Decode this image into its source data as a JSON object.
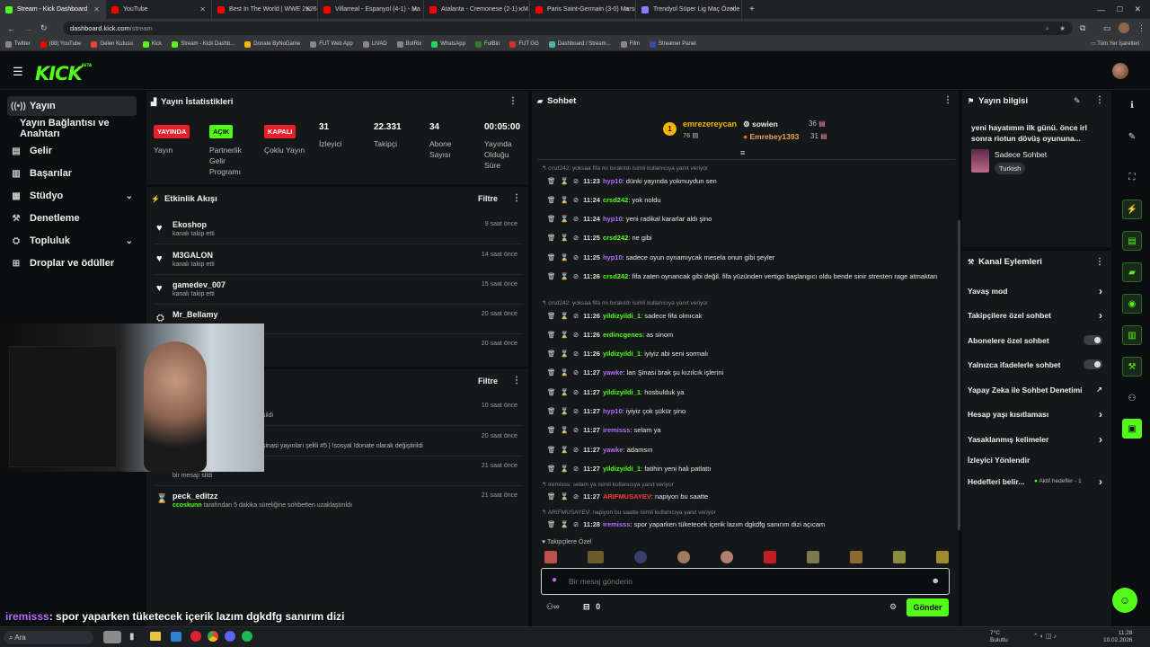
{
  "browser": {
    "tabs": [
      {
        "label": "Stream - Kick Dashboard",
        "color": "#53fc18",
        "active": true
      },
      {
        "label": "YouTube",
        "color": "#ff0000",
        "active": false
      },
      {
        "label": "Best In The World | WWE 2K26",
        "color": "#ff0000",
        "active": false
      },
      {
        "label": "Villarreal - Espanyol (4-1) - Ma",
        "color": "#ff0000",
        "active": false
      },
      {
        "label": "Atalanta - Cremonese (2-1) - M",
        "color": "#ff0000",
        "active": false
      },
      {
        "label": "Paris Saint-Germain (3-0) Marsi",
        "color": "#ff0000",
        "active": false
      },
      {
        "label": "Trendyol Süper Lig Maç Özetle",
        "color": "#8a7cff",
        "active": false
      }
    ],
    "url_domain": "dashboard.kick.com",
    "url_path": "/stream",
    "bookmarks": [
      {
        "label": "Twitter",
        "color": "#888"
      },
      {
        "label": "(88) YouTube",
        "color": "#ff0000"
      },
      {
        "label": "Gelen Kutusu",
        "color": "#ea4335"
      },
      {
        "label": "Kick",
        "color": "#53fc18"
      },
      {
        "label": "Stream - Kick Dashb...",
        "color": "#53fc18"
      },
      {
        "label": "Donate ByNoGame",
        "color": "#f5b400"
      },
      {
        "label": "FUT Web App",
        "color": "#888"
      },
      {
        "label": "LIVAD",
        "color": "#888"
      },
      {
        "label": "BotRix",
        "color": "#888"
      },
      {
        "label": "WhatsApp",
        "color": "#25d366"
      },
      {
        "label": "FutBin",
        "color": "#2e7d32"
      },
      {
        "label": "FUT GG",
        "color": "#d32f2f"
      },
      {
        "label": "Dashboard / Stream...",
        "color": "#4db6ac"
      },
      {
        "label": "Film",
        "color": "#888"
      },
      {
        "label": "Streamer Panel",
        "color": "#3949ab"
      }
    ],
    "all_bookmarks": "Tüm Yer İşaretleri"
  },
  "app": {
    "logo": "KICK",
    "logo_beta": "BETA",
    "accent": "#53fc18"
  },
  "sidebar": {
    "items": [
      {
        "label": "Yayın",
        "icon": "broadcast-icon"
      },
      {
        "label": "Yayın Bağlantısı ve Anahtarı",
        "icon": ""
      },
      {
        "label": "Gelir",
        "icon": "revenue-icon"
      },
      {
        "label": "Başarılar",
        "icon": "achievements-icon"
      },
      {
        "label": "Stüdyo",
        "icon": "studio-icon"
      },
      {
        "label": "Denetleme",
        "icon": "moderation-icon"
      },
      {
        "label": "Topluluk",
        "icon": "community-icon"
      },
      {
        "label": "Droplar ve ödüller",
        "icon": "gift-icon"
      }
    ]
  },
  "stats": {
    "title": "Yayın İstatistikleri",
    "items": [
      {
        "badge": "YAYINDA",
        "label": "Yayın"
      },
      {
        "badge": "AÇIK",
        "label": "Partnerlik Gelir Programı"
      },
      {
        "badge": "KAPALI",
        "label": "Çoklu Yayın"
      },
      {
        "value": "31",
        "label": "İzleyici"
      },
      {
        "value": "22.331",
        "label": "Takipçi"
      },
      {
        "value": "34",
        "label": "Abone Sayısı"
      },
      {
        "value": "00:05:00",
        "label": "Yayında Olduğu Süre"
      }
    ]
  },
  "activity": {
    "title": "Etkinlik Akışı",
    "filter": "Filtre",
    "items": [
      {
        "name": "Ekoshop",
        "sub": "kanalı takip etti",
        "time": "9 saat önce"
      },
      {
        "name": "M3GALON",
        "sub": "kanalı takip etti",
        "time": "14 saat önce"
      },
      {
        "name": "gamedev_007",
        "sub": "kanalı takip etti",
        "time": "15 saat önce"
      },
      {
        "name": "Mr_Bellamy",
        "sub": "",
        "time": "20 saat önce"
      },
      {
        "name": "",
        "sub": "",
        "time": "20 saat önce"
      }
    ]
  },
  "modlog": {
    "filter": "Filtre",
    "items": [
      {
        "name": "",
        "sub": "sildi",
        "time": "10 saat önce"
      },
      {
        "name": "",
        "sub": "şinasi yayınları şekli #5 | !sosyal !donate olarak değiştirildi",
        "time": "20 saat önce"
      },
      {
        "name": "",
        "sub": "bir mesajı sildi",
        "time": "21 saat önce"
      },
      {
        "name": "peck_editzz",
        "sub_user": "ccoskunn",
        "sub": "tarafından 5 dakika süreliğine sohbetten uzaklaştırıldı",
        "time": "21 saat önce"
      }
    ]
  },
  "chat": {
    "title": "Sohbet",
    "leaders": [
      {
        "rank": "1",
        "name": "emrezereycan",
        "count": "76"
      },
      {
        "name": "sowien",
        "count": "36"
      },
      {
        "name": "Emrebey1393",
        "count": "31"
      }
    ],
    "messages": [
      {
        "reply": "crsd242: yoksaa fifa mı bırakıldı isimli kullanıcıya yanıt veriyor"
      },
      {
        "time": "11:23",
        "user": "hyp10",
        "color": "#b56bff",
        "text": "dünki yayında yokmuydun sen"
      },
      {
        "time": "11:24",
        "user": "crsd242",
        "color": "#53fc18",
        "text": "yok noldu"
      },
      {
        "time": "11:24",
        "user": "hyp10",
        "color": "#b56bff",
        "text": "yeni radikal kararlar aldı şino"
      },
      {
        "time": "11:25",
        "user": "crsd242",
        "color": "#53fc18",
        "text": "ne gibi"
      },
      {
        "time": "11:25",
        "user": "hyp10",
        "color": "#b56bff",
        "text": "sadece oyun oynamıycak mesela onun gibi şeyler"
      },
      {
        "time": "11:26",
        "user": "crsd242",
        "color": "#53fc18",
        "text": "fifa zaten oynancak gibi değil. fifa yüzünden vertigo başlangıcı oldu bende sinir stresten rage atmaktan"
      },
      {
        "reply": "crsd242: yoksaa fifa mı bırakıldı isimli kullanıcıya yanıt veriyor"
      },
      {
        "time": "11:26",
        "user": "yildizyildi_1",
        "color": "#53fc18",
        "text": "sadece fifa olmıcak"
      },
      {
        "time": "11:26",
        "user": "erdincgenes",
        "color": "#53fc18",
        "text": "as sinom"
      },
      {
        "time": "11:26",
        "user": "yildizyildi_1",
        "color": "#53fc18",
        "text": "iyiyiz abi seni sormalı"
      },
      {
        "time": "11:27",
        "user": "yawke",
        "color": "#b56bff",
        "text": "lan Şinasi brak şu kızılcık işlerini"
      },
      {
        "time": "11:27",
        "user": "yildizyildi_1",
        "color": "#53fc18",
        "text": "hosbulduk ya"
      },
      {
        "time": "11:27",
        "user": "hyp10",
        "color": "#b56bff",
        "text": "iyiyiz çok şükür şino"
      },
      {
        "time": "11:27",
        "user": "iremisss",
        "color": "#b56bff",
        "text": "selam ya"
      },
      {
        "time": "11:27",
        "user": "yawke",
        "color": "#b56bff",
        "text": "adamsın"
      },
      {
        "time": "11:27",
        "user": "yildizyildi_1",
        "color": "#53fc18",
        "text": "fatihin yeni hali patlattı"
      },
      {
        "reply": "iremisss: selam ya isimli kullanıcıya yanıt veriyor"
      },
      {
        "time": "11:27",
        "user": "ARIFMUSAYEV",
        "color": "#ff3b3b",
        "text": "napiyon bu saatte"
      },
      {
        "reply": "ARIFMUSAYEV: napiyon bu saatte isimli kullanıcıya yanıt veriyor"
      },
      {
        "time": "11:28",
        "user": "iremisss",
        "color": "#b56bff",
        "text": "spor yaparken tüketecek içerik lazım dgkdfg sanırım dizi açıcam"
      }
    ],
    "followers_only": "Takipçilere Özel",
    "placeholder": "Bir mesaj gönderin",
    "count": "0",
    "send": "Gönder"
  },
  "streaminfo": {
    "title": "Yayın bilgisi",
    "stream_title": "yeni hayatımın ilk günü. önce irl sonra riotun dövüş oyununa...",
    "category": "Sadece Sohbet",
    "language": "Turkish"
  },
  "channel_actions": {
    "title": "Kanal Eylemleri",
    "items": [
      {
        "label": "Yavaş mod",
        "kind": "arrow"
      },
      {
        "label": "Takipçilere özel sohbet",
        "kind": "arrow"
      },
      {
        "label": "Abonelere özel sohbet",
        "kind": "toggle"
      },
      {
        "label": "Yalnızca ifadelerle sohbet",
        "kind": "toggle"
      },
      {
        "label": "Yapay Zeka ile Sohbet Denetimi",
        "kind": "link"
      },
      {
        "label": "Hesap yaşı kısıtlaması",
        "kind": "arrow"
      },
      {
        "label": "Yasaklanmış kelimeler",
        "kind": "arrow"
      },
      {
        "label": "İzleyici Yönlendir",
        "kind": "none"
      },
      {
        "label": "Hedefleri belir...",
        "kind": "goal",
        "extra": "Aktif hedefler - 1"
      }
    ]
  },
  "overlay": {
    "chat_user": "iremisss",
    "chat_text": ": spor yaparken tüketecek içerik lazım dgkdfg sanırım dizi"
  },
  "taskbar": {
    "search": "Ara",
    "weather": "7°C",
    "weather_sub": "Bulutlu",
    "time": "11:28",
    "date": "10.02.2026"
  }
}
